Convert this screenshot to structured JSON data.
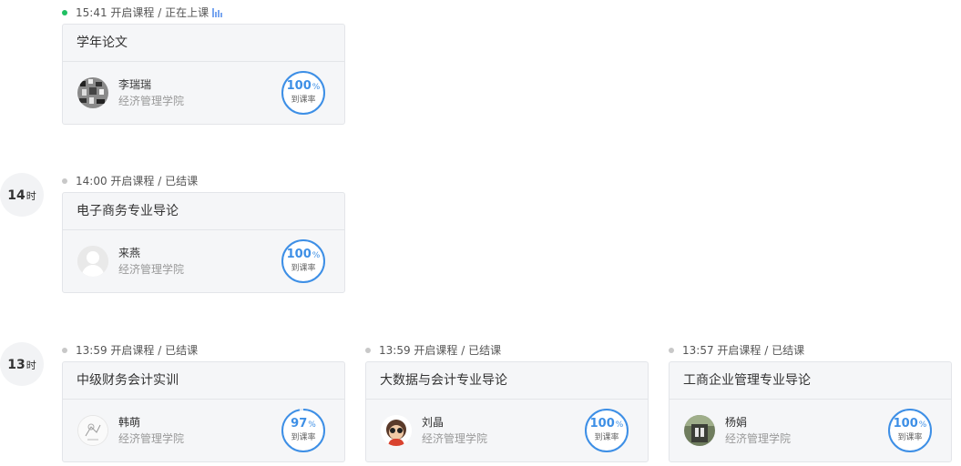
{
  "hours": [
    {
      "num": "14",
      "unit": "时"
    },
    {
      "num": "13",
      "unit": "时"
    }
  ],
  "sessions": [
    {
      "status": "15:41 开启课程 / 正在上课",
      "live": true,
      "course": "学年论文",
      "teacher": "李瑞瑞",
      "dept": "经济管理学院",
      "rate": "100",
      "rate_value": 100,
      "rate_unit": "%",
      "rate_label": "到课率"
    },
    {
      "status": "14:00 开启课程 / 已结课",
      "live": false,
      "course": "电子商务专业导论",
      "teacher": "来燕",
      "dept": "经济管理学院",
      "rate": "100",
      "rate_value": 100,
      "rate_unit": "%",
      "rate_label": "到课率"
    },
    {
      "status": "13:59 开启课程 / 已结课",
      "live": false,
      "course": "中级财务会计实训",
      "teacher": "韩萌",
      "dept": "经济管理学院",
      "rate": "97",
      "rate_value": 97,
      "rate_unit": "%",
      "rate_label": "到课率"
    },
    {
      "status": "13:59 开启课程 / 已结课",
      "live": false,
      "course": "大数据与会计专业导论",
      "teacher": "刘晶",
      "dept": "经济管理学院",
      "rate": "100",
      "rate_value": 100,
      "rate_unit": "%",
      "rate_label": "到课率"
    },
    {
      "status": "13:57 开启课程 / 已结课",
      "live": false,
      "course": "工商企业管理专业导论",
      "teacher": "杨娟",
      "dept": "经济管理学院",
      "rate": "100",
      "rate_value": 100,
      "rate_unit": "%",
      "rate_label": "到课率"
    }
  ],
  "colors": {
    "ring": "#3d8fe6",
    "live_dot": "#1fbf62",
    "idle_dot": "#c8c8c8"
  }
}
